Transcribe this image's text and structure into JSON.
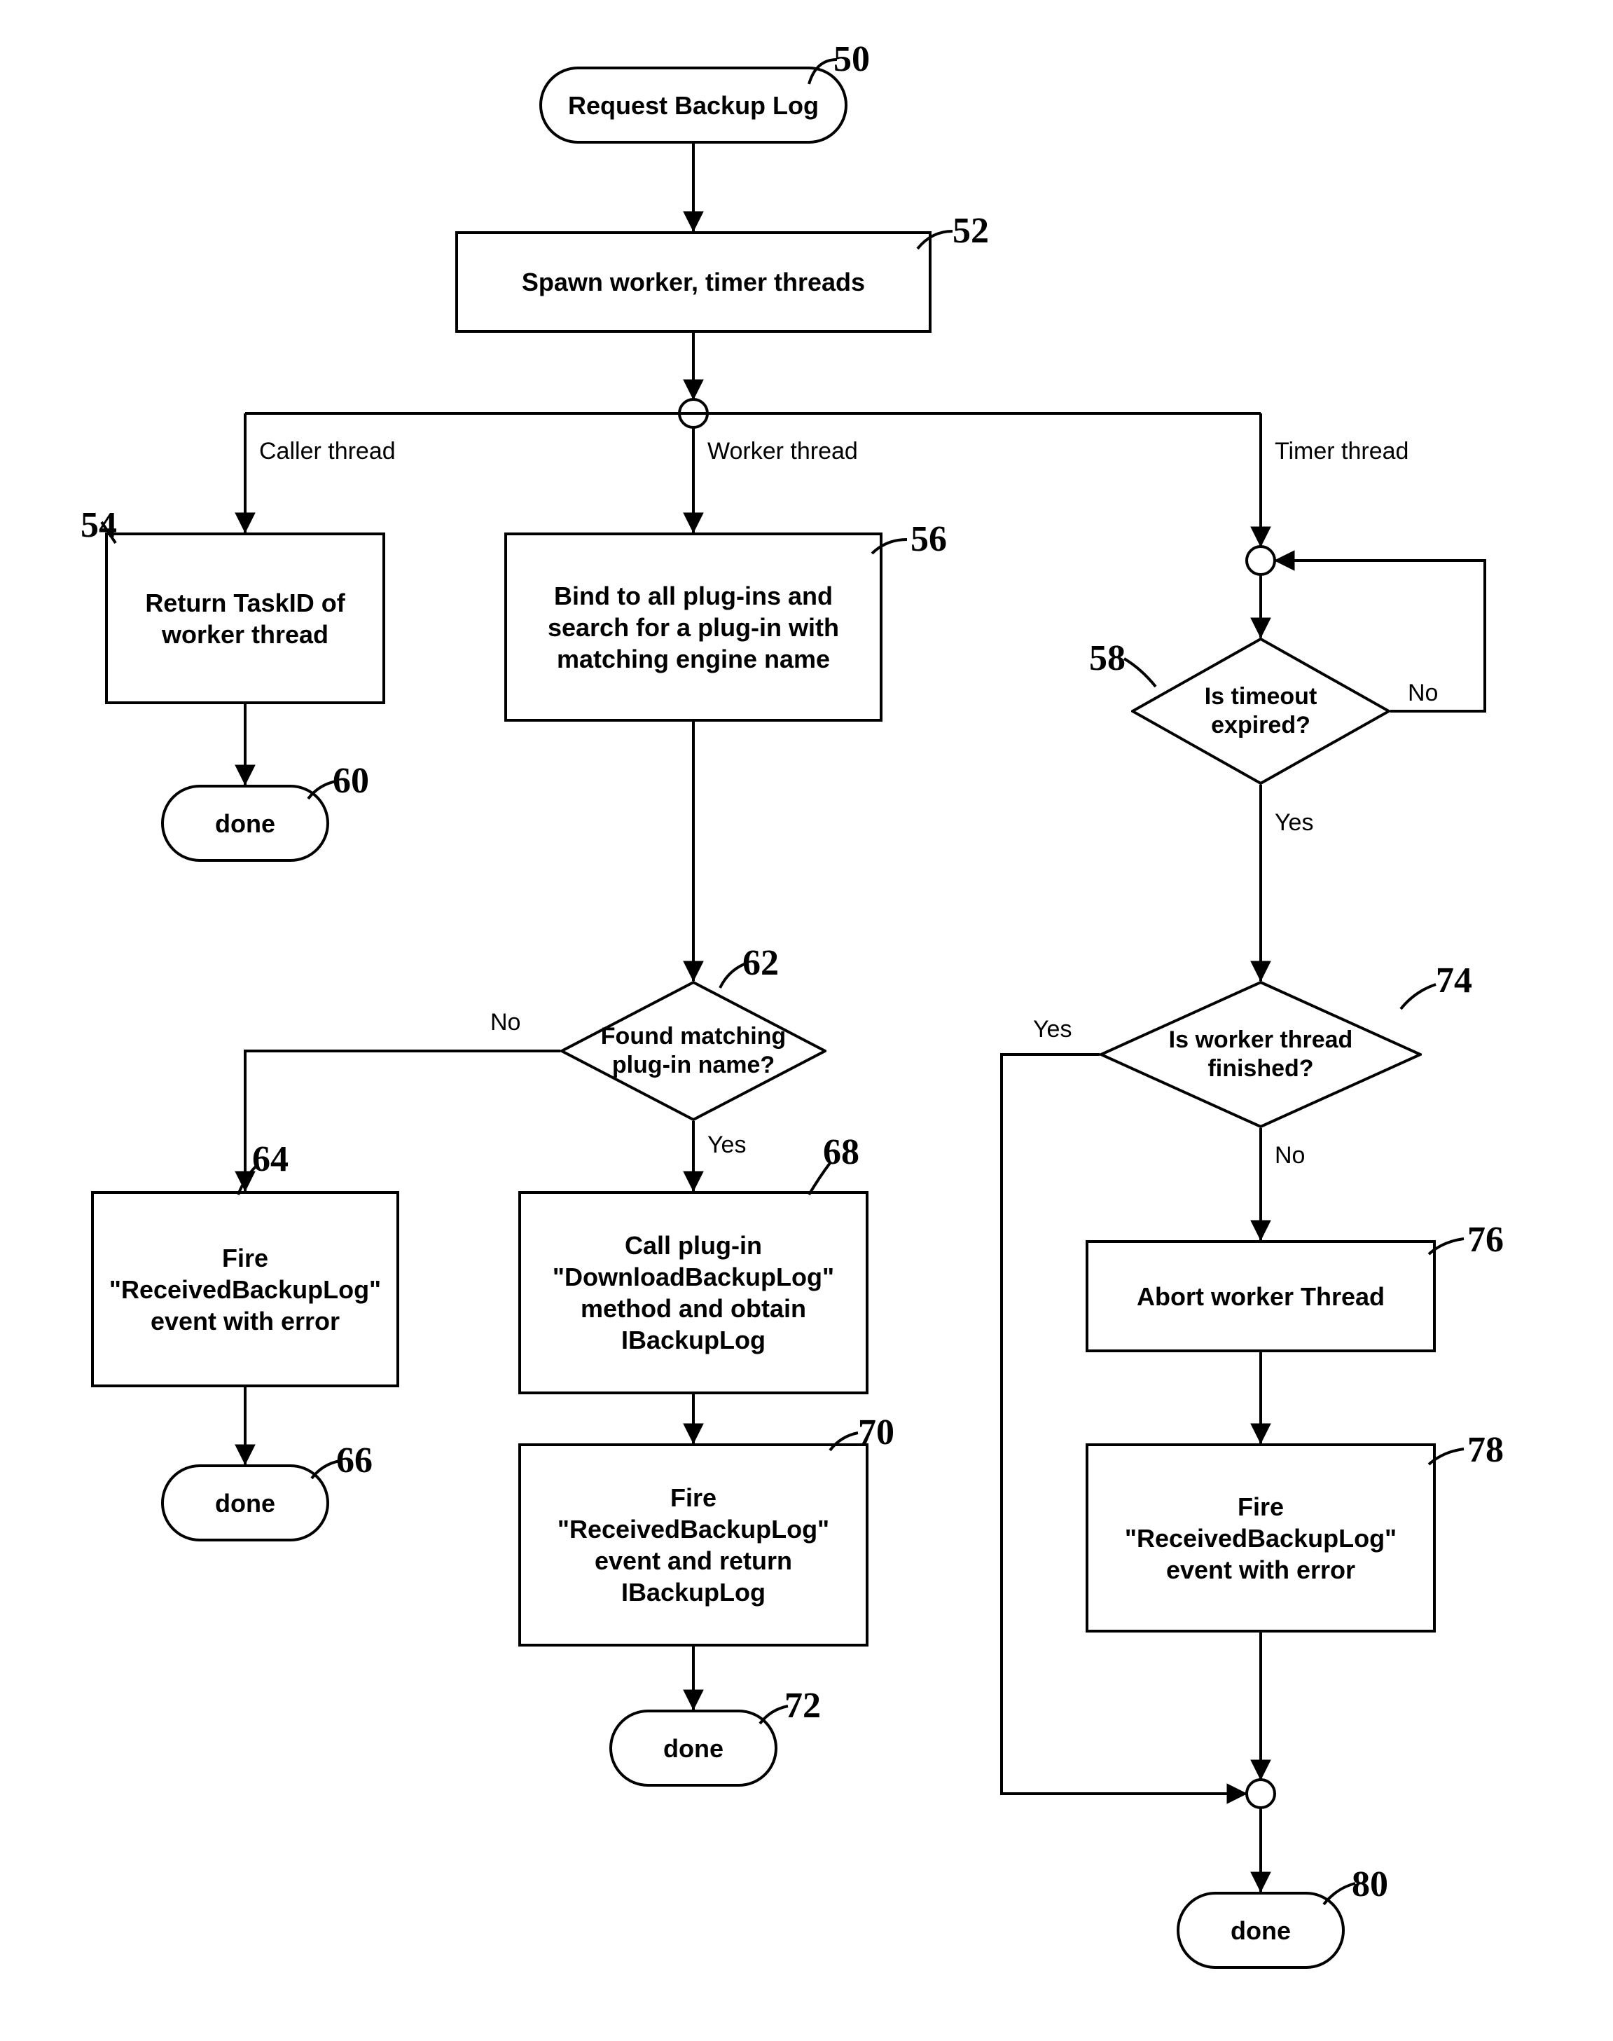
{
  "diagram": {
    "title": "Request Backup Log flowchart",
    "nodes": {
      "start": {
        "text": "Request Backup Log",
        "ref": "50"
      },
      "spawn": {
        "text": "Spawn worker, timer threads",
        "ref": "52"
      },
      "caller_return": {
        "text": "Return TaskID of worker thread",
        "ref": "54"
      },
      "caller_done": {
        "text": "done",
        "ref": "60"
      },
      "worker_bind": {
        "text": "Bind to all plug-ins and search for a plug-in with matching engine name",
        "ref": "56"
      },
      "worker_found": {
        "text": "Found matching plug-in name?",
        "ref": "62"
      },
      "worker_fire_err": {
        "text": "Fire \"ReceivedBackupLog\" event with error",
        "ref": "64"
      },
      "worker_done_err": {
        "text": "done",
        "ref": "66"
      },
      "worker_call": {
        "text": "Call plug-in \"DownloadBackupLog\" method and obtain IBackupLog",
        "ref": "68"
      },
      "worker_fire_ok": {
        "text": "Fire \"ReceivedBackupLog\" event and return IBackupLog",
        "ref": "70"
      },
      "worker_done_ok": {
        "text": "done",
        "ref": "72"
      },
      "timer_timeout": {
        "text": "Is timeout expired?",
        "ref": "58"
      },
      "timer_finished": {
        "text": "Is worker thread finished?",
        "ref": "74"
      },
      "timer_abort": {
        "text": "Abort worker Thread",
        "ref": "76"
      },
      "timer_fire_err": {
        "text": "Fire \"ReceivedBackupLog\" event with error",
        "ref": "78"
      },
      "timer_done": {
        "text": "done",
        "ref": "80"
      }
    },
    "branch_labels": {
      "caller": "Caller thread",
      "worker": "Worker thread",
      "timer": "Timer thread",
      "yes": "Yes",
      "no": "No"
    }
  }
}
